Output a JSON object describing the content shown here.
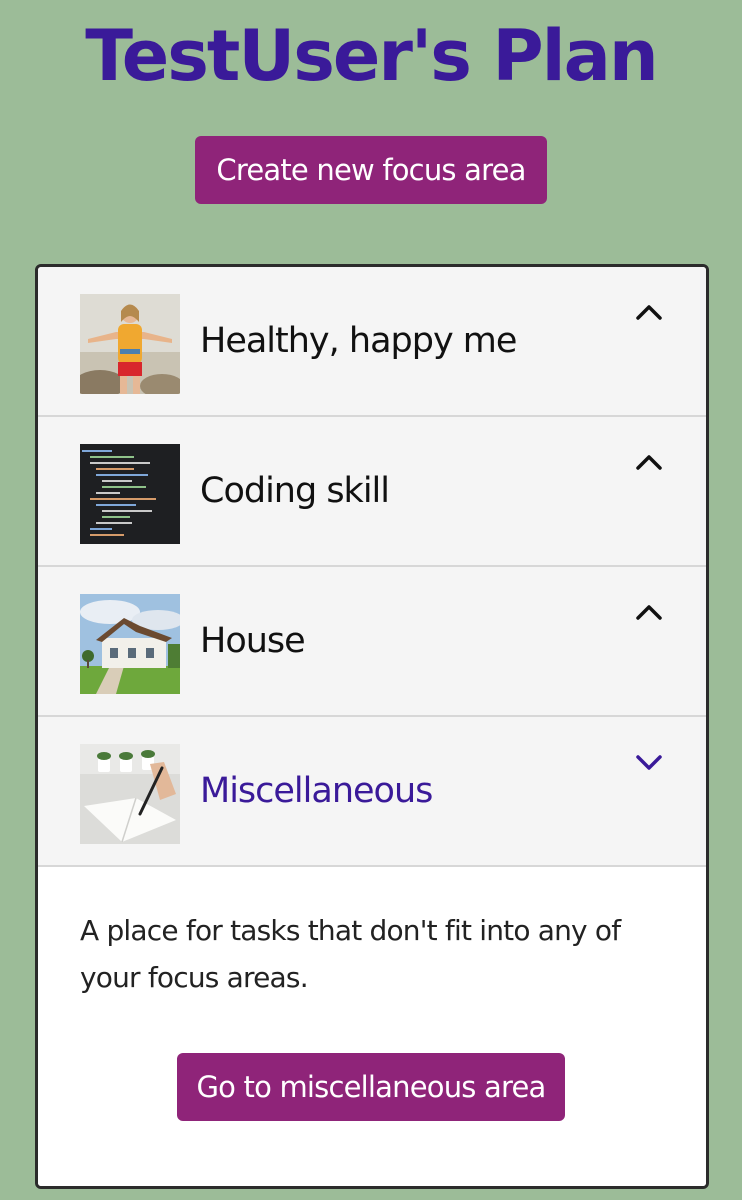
{
  "page": {
    "title": "TestUser's Plan",
    "create_button": "Create new focus area"
  },
  "colors": {
    "background": "#9cbc98",
    "title": "#3a1a99",
    "button": "#8f2479",
    "header_bg": "#f5f5f5",
    "active_label": "#3a1a99"
  },
  "focus_areas": [
    {
      "label": "Healthy, happy me",
      "icon": "chevron-up-icon",
      "image": "hiker-photo",
      "expanded": false
    },
    {
      "label": "Coding skill",
      "icon": "chevron-up-icon",
      "image": "code-editor-photo",
      "expanded": false
    },
    {
      "label": "House",
      "icon": "chevron-up-icon",
      "image": "house-photo",
      "expanded": false
    },
    {
      "label": "Miscellaneous",
      "icon": "chevron-down-icon",
      "image": "notebook-writing-photo",
      "expanded": true
    }
  ],
  "expanded_panel": {
    "description": "A place for tasks that don't fit into any of your focus areas.",
    "button": "Go to miscellaneous area"
  }
}
